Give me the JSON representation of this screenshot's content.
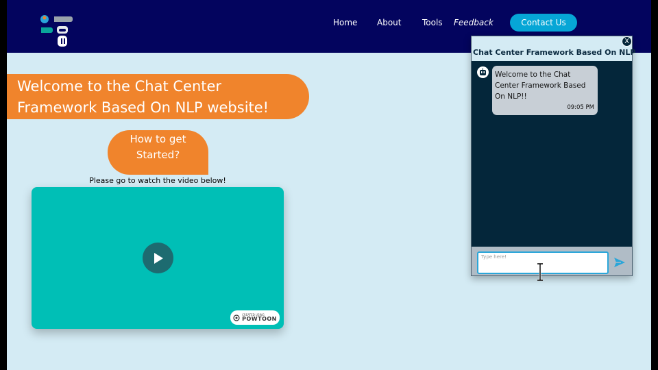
{
  "nav": {
    "links": [
      "Home",
      "About",
      "Tools",
      "Feedback"
    ],
    "contact_label": "Contact Us"
  },
  "hero": {
    "title_line1": "Welcome to the Chat Center",
    "title_line2": "Framework Based On NLP website!",
    "how_line1": "How to get",
    "how_line2": "Started?",
    "watch_text": "Please go to watch the video below!"
  },
  "video": {
    "badge_small": "CREATED USING",
    "badge_brand": "POWTOON",
    "play_icon": "play-icon"
  },
  "chat": {
    "title": "Chat Center Framework Based On NLP",
    "close_label": "X",
    "message_line1": "Welcome to the Chat",
    "message_line2": "Center Framework Based",
    "message_line3": "On NLP!!",
    "message_time": "09:05 PM",
    "input_placeholder": "Type here!"
  },
  "colors": {
    "navbar": "#03045e",
    "page_bg": "#d4ebf4",
    "accent_orange": "#f0842c",
    "contact_button": "#06a6d6",
    "video_bg": "#00bfb6",
    "chat_bg": "#04263a"
  }
}
